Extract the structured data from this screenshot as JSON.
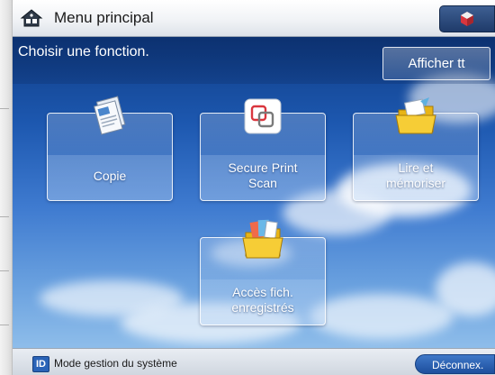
{
  "header": {
    "title": "Menu principal",
    "home_icon": "home-icon",
    "corner_icon": "cube-icon"
  },
  "main": {
    "subtitle": "Choisir une fonction.",
    "show_all_label": "Afficher tt",
    "functions": [
      {
        "line1": "Copie",
        "line2": "",
        "icon": "copy-icon"
      },
      {
        "line1": "Secure Print",
        "line2": "Scan",
        "icon": "secure-print-scan-icon"
      },
      {
        "line1": "Lire et",
        "line2": "mémoriser",
        "icon": "folder-icon"
      },
      {
        "line1": "Accès fich.",
        "line2": "enregistrés",
        "icon": "stored-files-icon"
      }
    ]
  },
  "statusbar": {
    "mode_badge": "ID",
    "mode_text": "Mode gestion du système",
    "logout_label": "Déconnex."
  },
  "colors": {
    "accent_blue": "#1d58b0",
    "corner_button": "#1f3b6a"
  }
}
